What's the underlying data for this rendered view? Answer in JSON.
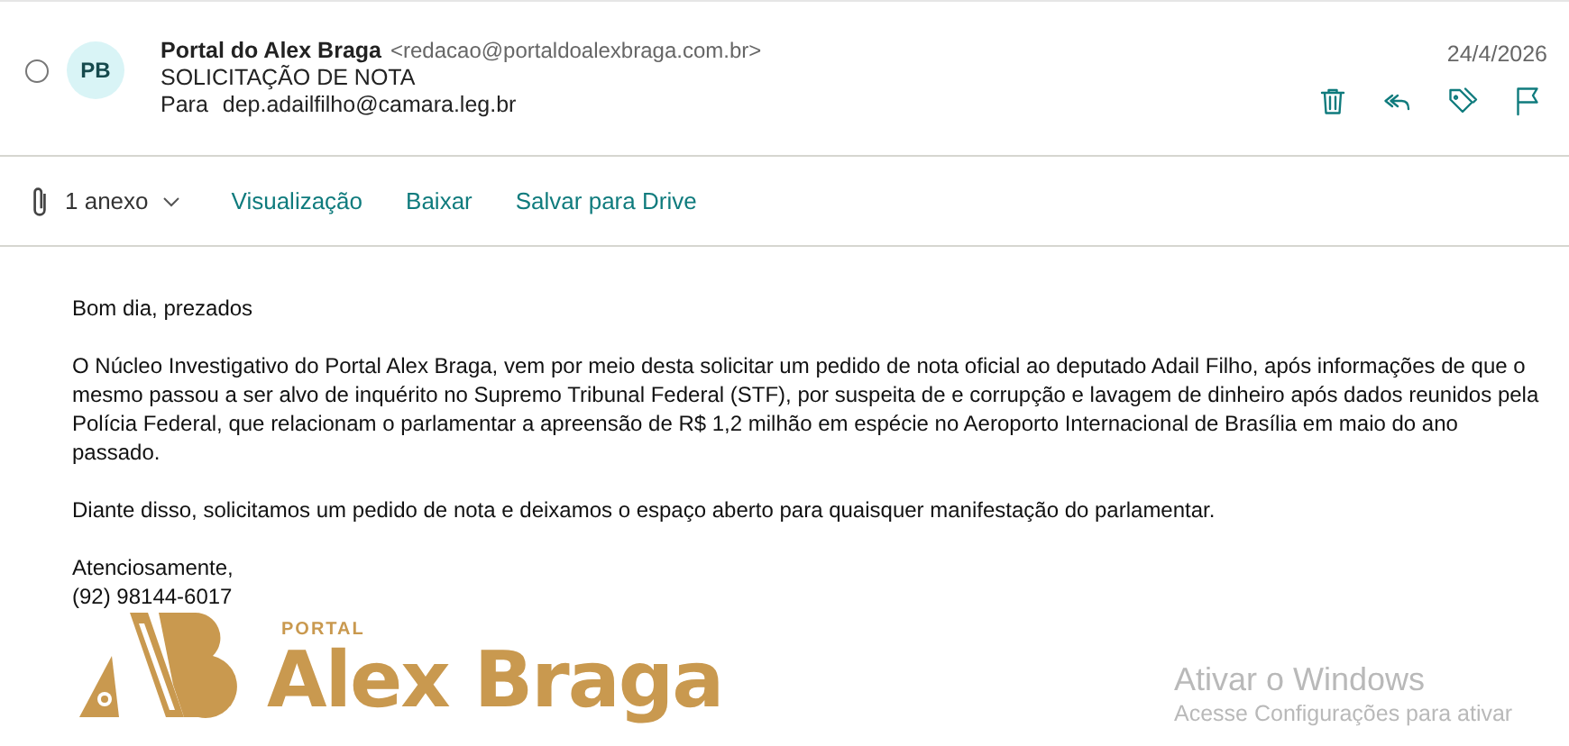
{
  "message": {
    "selected": false,
    "avatar": "PB",
    "sender_name": "Portal do Alex Braga",
    "sender_email": "<redacao@portaldoalexbraga.com.br>",
    "subject": "SOLICITAÇÃO DE NOTA",
    "to_label": "Para",
    "to": "dep.adailfilho@camara.leg.br",
    "date": "24/4/2026"
  },
  "attachments": {
    "count": "1 anexo",
    "actions": [
      "Visualização",
      "Baixar",
      "Salvar para Drive"
    ]
  },
  "body": {
    "paragraphs": [
      "Bom dia, prezados",
      "O Núcleo Investigativo do Portal Alex Braga, vem por meio desta solicitar um pedido de nota oficial ao deputado Adail Filho, após informações de que o mesmo passou a ser alvo de inquérito no Supremo Tribunal Federal (STF), por suspeita de e corrupção e lavagem de dinheiro após dados reunidos pela Polícia Federal, que relacionam o parlamentar a apreensão de R$ 1,2 milhão em espécie no Aeroporto Internacional de Brasília em maio do ano passado.",
      "Diante disso, solicitamos um pedido de nota e deixamos o espaço aberto para quaisquer manifestação do parlamentar."
    ],
    "signature": [
      "Atenciosamente,",
      "(92) 98144-6017"
    ],
    "logo": {
      "small": "PORTAL",
      "large": "Alex Braga"
    }
  },
  "activation_notice": {
    "title": "Ativar o Windows",
    "subtitle": "Acesse Configurações para ativar"
  }
}
